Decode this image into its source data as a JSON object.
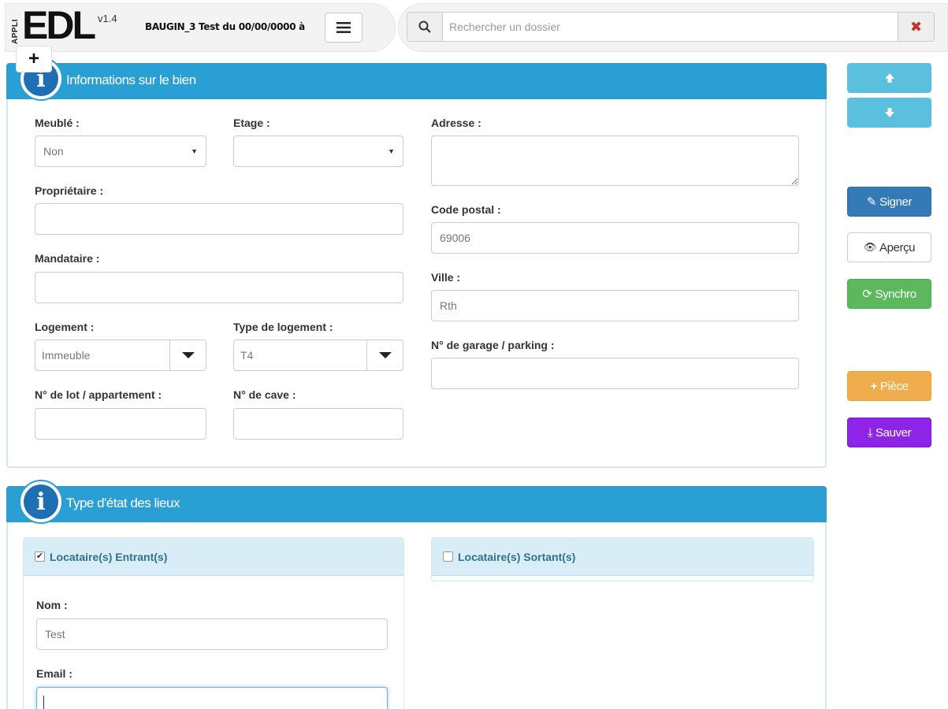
{
  "app": {
    "logo_prefix": "APPLI",
    "logo_main": "EDL",
    "version": "v1.4",
    "dossier_label": "BAUGIN_3 Test du 00/00/0000 à"
  },
  "search": {
    "placeholder": "Rechercher un dossier",
    "value": ""
  },
  "toolbar": {
    "plus_label": "+"
  },
  "info_panel": {
    "title": "Informations sur le bien",
    "icon_glyph": "i",
    "meuble": {
      "label": "Meublé :",
      "value": "Non"
    },
    "etage": {
      "label": "Etage :",
      "value": ""
    },
    "adresse": {
      "label": "Adresse :",
      "value": ""
    },
    "proprietaire": {
      "label": "Propriétaire :",
      "value": ""
    },
    "code_postal": {
      "label": "Code postal :",
      "value": "69006"
    },
    "mandataire": {
      "label": "Mandataire :",
      "value": ""
    },
    "ville": {
      "label": "Ville :",
      "value": "Rth"
    },
    "logement": {
      "label": "Logement :",
      "value": "Immeuble"
    },
    "type_logement": {
      "label": "Type de logement :",
      "value": "T4"
    },
    "garage": {
      "label": "N° de garage / parking :",
      "value": ""
    },
    "lot": {
      "label": "N° de lot / appartement :",
      "value": ""
    },
    "cave": {
      "label": "N° de cave :",
      "value": ""
    }
  },
  "type_panel": {
    "title": "Type d'état des lieux",
    "icon_glyph": "i",
    "entrant": {
      "label": "Locataire(s) Entrant(s)",
      "checked": true,
      "check_mark": "✔"
    },
    "sortant": {
      "label": "Locataire(s) Sortant(s)",
      "checked": false,
      "check_mark": ""
    },
    "nom": {
      "label": "Nom :",
      "value": "Test"
    },
    "email": {
      "label": "Email :",
      "value": ""
    }
  },
  "side_buttons": {
    "up_icon": "arrow-up-icon",
    "down_icon": "arrow-down-icon",
    "signer": "Signer",
    "apercu": "Aperçu",
    "synchro": "Synchro",
    "piece": "Pièce",
    "sauver": "Sauver"
  },
  "colors": {
    "header_blue": "#2a9fd3",
    "signer": "#337ab7",
    "synchro": "#5cb85c",
    "piece": "#f0ad4e",
    "sauver": "#8e24e6",
    "arrows": "#5bc0de"
  }
}
